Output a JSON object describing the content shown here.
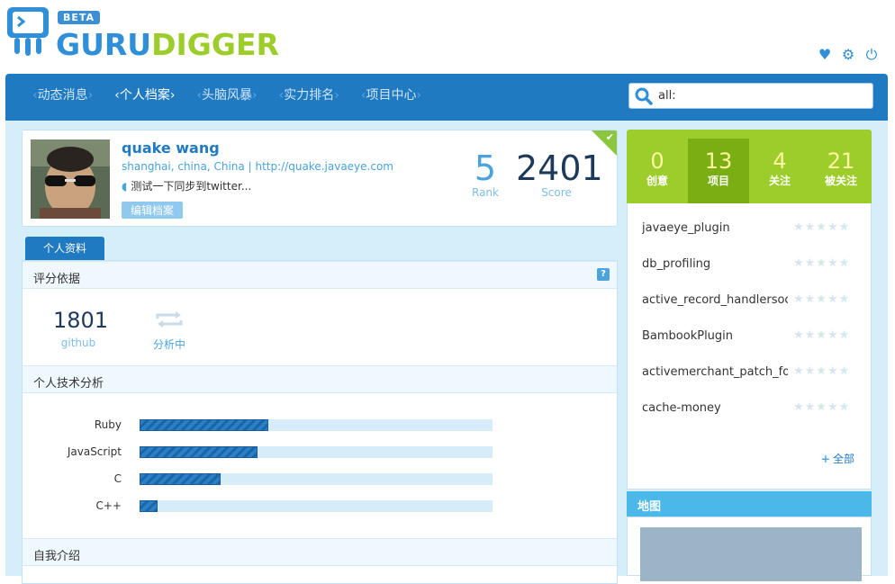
{
  "header": {
    "badge": "BETA",
    "logo_part1": "GURU",
    "logo_part2": "DIGGER",
    "icons": [
      "heart-icon",
      "gear-icon",
      "power-icon"
    ]
  },
  "nav": {
    "items": [
      {
        "label": "动态消息"
      },
      {
        "label": "个人档案"
      },
      {
        "label": "头脑风暴"
      },
      {
        "label": "实力排名"
      },
      {
        "label": "项目中心"
      }
    ],
    "active_index": 1
  },
  "search": {
    "value": "all:"
  },
  "profile": {
    "name": "quake wang",
    "location": "shanghai, china, China",
    "separator": "|",
    "homepage": "http://quake.javaeye.com",
    "status": "测试一下同步到twitter...",
    "edit_label": "编辑档案",
    "rank_value": "5",
    "rank_label": "Rank",
    "score_value": "2401",
    "score_label": "Score"
  },
  "tab": {
    "label": "个人资料"
  },
  "rating": {
    "title": "评分依据",
    "help": "?",
    "github_value": "1801",
    "github_label": "github",
    "analyzing_label": "分析中"
  },
  "skills": {
    "title": "个人技术分析",
    "items": [
      {
        "name": "Ruby",
        "level": 0.365
      },
      {
        "name": "JavaScript",
        "level": 0.335
      },
      {
        "name": "C",
        "level": 0.23
      },
      {
        "name": "C++",
        "level": 0.05
      }
    ]
  },
  "intro": {
    "title": "自我介绍"
  },
  "counts": [
    {
      "value": "0",
      "label": "创意"
    },
    {
      "value": "13",
      "label": "项目"
    },
    {
      "value": "4",
      "label": "关注"
    },
    {
      "value": "21",
      "label": "被关注"
    }
  ],
  "counts_active_index": 1,
  "projects": [
    {
      "name": "javaeye_plugin",
      "stars": "★★★★★"
    },
    {
      "name": "db_profiling",
      "stars": "★★★★★"
    },
    {
      "name": "active_record_handlersocket",
      "stars": "★★★★★"
    },
    {
      "name": "BambookPlugin",
      "stars": "★★★★★"
    },
    {
      "name": "activemerchant_patch_for",
      "stars": "★★★★★"
    },
    {
      "name": "cache-money",
      "stars": "★★★★★"
    }
  ],
  "all_link": {
    "plus": "+",
    "label": "全部"
  },
  "map": {
    "title": "地图"
  },
  "colors": {
    "primary": "#1f7ac2",
    "accent": "#9ccd2b",
    "light_bg": "#d4eefa"
  }
}
